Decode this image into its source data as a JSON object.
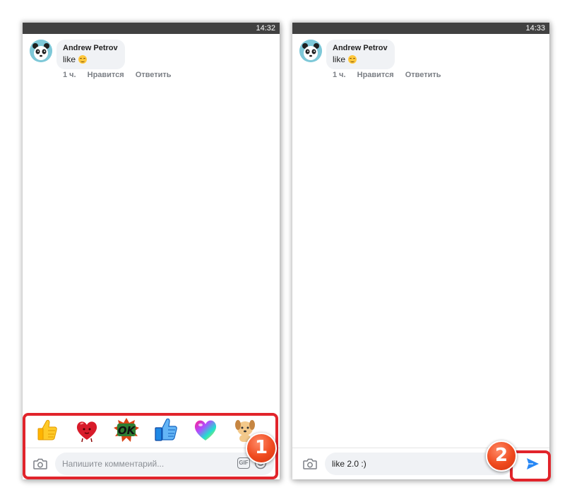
{
  "left_screen": {
    "status_time": "14:32",
    "comment": {
      "author": "Andrew Petrov",
      "text": "like"
    },
    "meta": {
      "time": "1 ч.",
      "like": "Нравится",
      "reply": "Ответить"
    },
    "stickers": [
      "thumbs-up",
      "heart",
      "ok",
      "thumbs-up-hand",
      "rainbow-heart",
      "dog"
    ],
    "input": {
      "placeholder": "Напишите комментарий..."
    },
    "gif_label": "GIF",
    "step_number": "1"
  },
  "right_screen": {
    "status_time": "14:33",
    "comment": {
      "author": "Andrew Petrov",
      "text": "like"
    },
    "meta": {
      "time": "1 ч.",
      "like": "Нравится",
      "reply": "Ответить"
    },
    "input": {
      "value": "like 2.0 :)"
    },
    "step_number": "2"
  },
  "colors": {
    "status_bar": "#414141",
    "highlight": "#e1242b",
    "badge": "#ef4a1e",
    "send": "#2787f5",
    "bubble": "#f0f2f5"
  }
}
